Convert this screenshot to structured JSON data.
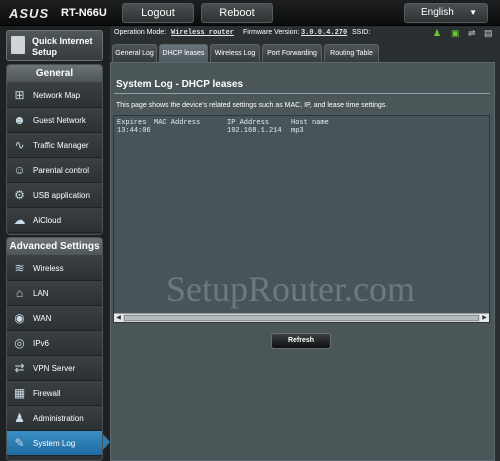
{
  "header": {
    "brand": "ASUS",
    "model": "RT-N66U",
    "logout_label": "Logout",
    "reboot_label": "Reboot",
    "language": "English"
  },
  "status_bar": {
    "op_mode_label": "Operation Mode:",
    "op_mode_value": "Wireless router",
    "firmware_label": "Firmware Version:",
    "firmware_value": "3.0.0.4.270",
    "ssid_label": "SSID:"
  },
  "sidebar": {
    "quick_setup_label": "Quick Internet Setup",
    "general_header": "General",
    "general_items": [
      {
        "label": "Network Map",
        "icon": "network-map-icon"
      },
      {
        "label": "Guest Network",
        "icon": "guest-network-icon"
      },
      {
        "label": "Traffic Manager",
        "icon": "traffic-manager-icon"
      },
      {
        "label": "Parental control",
        "icon": "parental-control-icon"
      },
      {
        "label": "USB application",
        "icon": "usb-icon"
      },
      {
        "label": "AiCloud",
        "icon": "cloud-icon"
      }
    ],
    "advanced_header": "Advanced Settings",
    "advanced_items": [
      {
        "label": "Wireless",
        "icon": "wireless-icon"
      },
      {
        "label": "LAN",
        "icon": "lan-icon"
      },
      {
        "label": "WAN",
        "icon": "wan-icon"
      },
      {
        "label": "IPv6",
        "icon": "ipv6-icon"
      },
      {
        "label": "VPN Server",
        "icon": "vpn-icon"
      },
      {
        "label": "Firewall",
        "icon": "firewall-icon"
      },
      {
        "label": "Administration",
        "icon": "administration-icon"
      },
      {
        "label": "System Log",
        "icon": "system-log-icon"
      }
    ]
  },
  "tabs": [
    {
      "label": "General Log"
    },
    {
      "label": "DHCP leases"
    },
    {
      "label": "Wireless Log"
    },
    {
      "label": "Port Forwarding"
    },
    {
      "label": "Routing Table"
    }
  ],
  "main": {
    "title": "System Log - DHCP leases",
    "description": "This page shows the device's related settings such as MAC, IP, and lease time settings.",
    "log_columns": [
      "Expires",
      "MAC Address",
      "IP Address",
      "Host name"
    ],
    "log_rows": [
      [
        "13:44:06",
        "",
        "192.168.1.214",
        "mp3"
      ]
    ],
    "refresh_label": "Refresh"
  },
  "watermark": "SetupRouter.com",
  "colors": {
    "active_item": "#2b7fb6",
    "status_icon": "#6acb2f"
  }
}
